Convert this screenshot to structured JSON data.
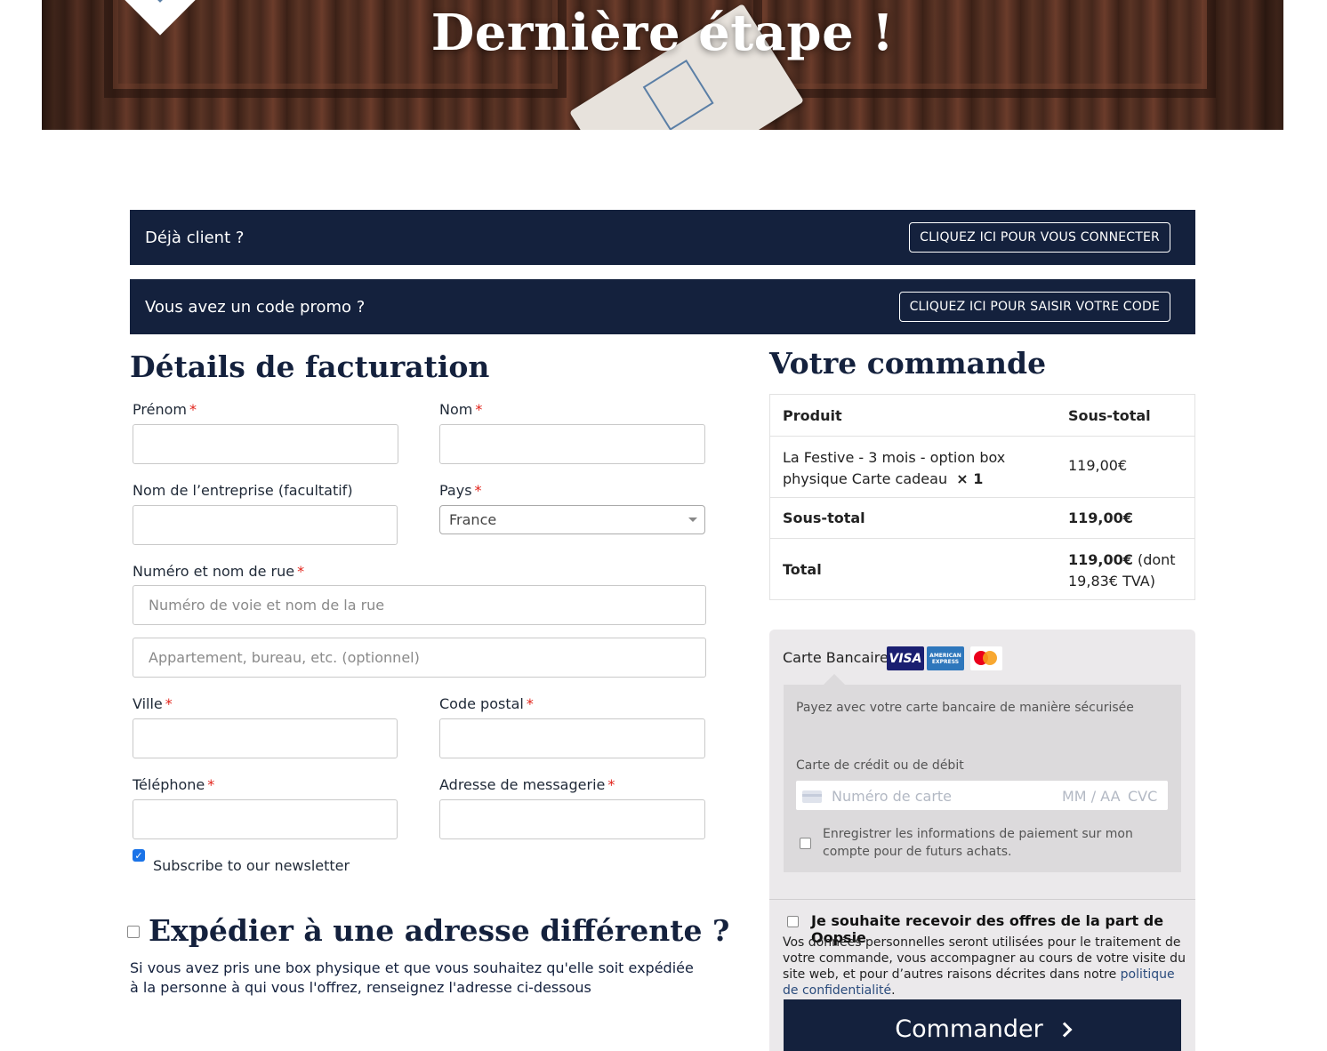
{
  "hero": {
    "title": "Dernière étape !"
  },
  "notices": {
    "login": {
      "text": "Déjà client ?",
      "button": "CLIQUEZ ICI POUR VOUS CONNECTER"
    },
    "coupon": {
      "text": "Vous avez un code promo ?",
      "button": "CLIQUEZ ICI POUR SAISIR VOTRE CODE"
    }
  },
  "billing": {
    "title": "Détails de facturation",
    "required_mark": "*",
    "first_name": {
      "label": "Prénom",
      "value": ""
    },
    "last_name": {
      "label": "Nom",
      "value": ""
    },
    "company": {
      "label": "Nom de l’entreprise (facultatif)",
      "value": ""
    },
    "country": {
      "label": "Pays",
      "value": "France"
    },
    "street": {
      "label": "Numéro et nom de rue",
      "placeholder_1": "Numéro de voie et nom de la rue",
      "placeholder_2": "Appartement, bureau, etc. (optionnel)"
    },
    "city": {
      "label": "Ville",
      "value": ""
    },
    "postcode": {
      "label": "Code postal",
      "value": ""
    },
    "phone": {
      "label": "Téléphone",
      "value": ""
    },
    "email": {
      "label": "Adresse de messagerie",
      "value": ""
    },
    "newsletter": {
      "label": "Subscribe to our newsletter",
      "checked": true
    }
  },
  "shipping": {
    "title": "Expédier à une adresse différente ?",
    "checked": false,
    "description": "Si vous avez pris une box physique et que vous souhaitez qu'elle soit expédiée à la personne à qui vous l'offrez, renseignez l'adresse ci-dessous"
  },
  "order": {
    "title": "Votre commande",
    "headers": {
      "product": "Produit",
      "subtotal": "Sous-total"
    },
    "item": {
      "name_line1": "La Festive - 3 mois - option box",
      "name_line2": "physique Carte cadeau",
      "qty": "× 1",
      "price": "119,00€"
    },
    "subtotal": {
      "label": "Sous-total",
      "value": "119,00€"
    },
    "total": {
      "label": "Total",
      "value": "119,00€",
      "tax_suffix": " (dont",
      "tax_line2": "19,83€ TVA)"
    }
  },
  "payment": {
    "method_label": "Carte Bancaire",
    "card_brands": [
      "VISA",
      "AMERICAN EXPRESS",
      "mastercard"
    ],
    "amex_text": "AMERICAN EXPRESS",
    "visa_text": "VISA",
    "description": "Payez avec votre carte bancaire de manière sécurisée",
    "card_label": "Carte de crédit ou de débit",
    "card_number_placeholder": "Numéro de carte",
    "expiry_placeholder": "MM / AA",
    "cvc_placeholder": "CVC",
    "save_label": "Enregistrer les informations de paiement sur mon compte pour de futurs achats.",
    "offers_label": "Je souhaite recevoir des offres de la part de Oopsie",
    "privacy_text": "Vos données personnelles seront utilisées pour le traitement de votre commande, vous accompagner au cours de votre visite du site web, et pour d’autres raisons décrites dans notre ",
    "privacy_link": "politique de confidentialité",
    "privacy_end": ".",
    "submit": "Commander"
  },
  "colors": {
    "navy": "#14213d",
    "required": "#e2231a",
    "checkbox_blue": "#1a73e8"
  }
}
